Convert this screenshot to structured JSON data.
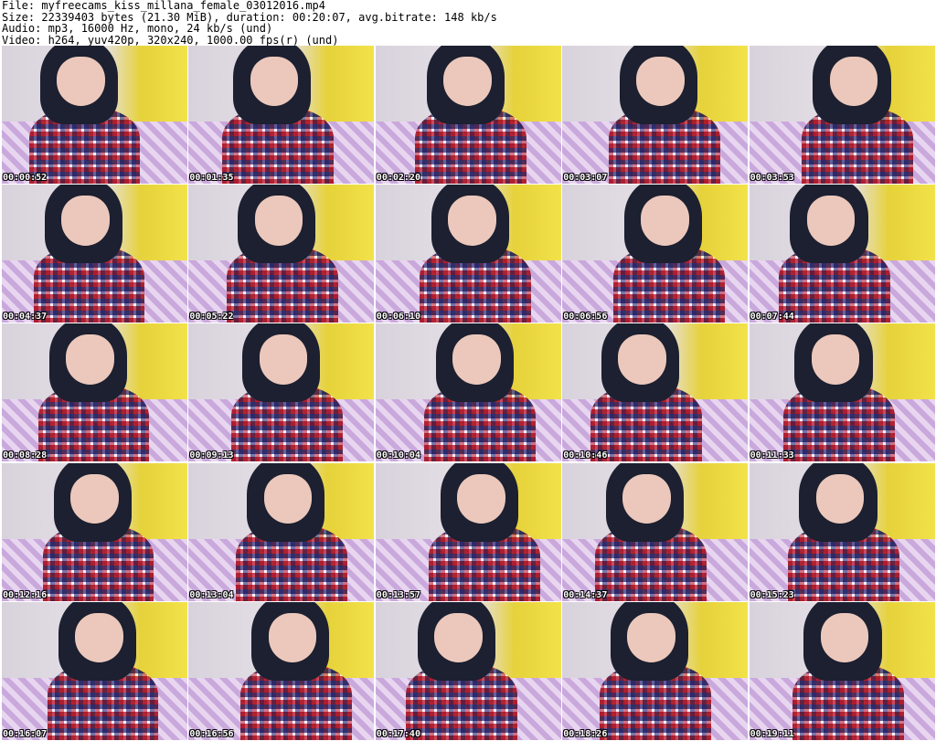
{
  "header": {
    "file": "File: myfreecams_kiss_millana_female_03012016.mp4",
    "size": "Size: 22339403 bytes (21.30 MiB), duration: 00:20:07, avg.bitrate: 148 kb/s",
    "audio": "Audio: mp3, 16000 Hz, mono, 24 kb/s (und)",
    "video": "Video: h264, yuv420p, 320x240, 1000.00 fps(r) (und)"
  },
  "thumbnails": [
    "00:00:52",
    "00:01:35",
    "00:02:20",
    "00:03:07",
    "00:03:53",
    "00:04:37",
    "00:05:22",
    "00:06:10",
    "00:06:56",
    "00:07:44",
    "00:08:28",
    "00:09:13",
    "00:10:04",
    "00:10:46",
    "00:11:33",
    "00:12:16",
    "00:13:04",
    "00:13:57",
    "00:14:37",
    "00:15:23",
    "00:16:07",
    "00:16:56",
    "00:17:40",
    "00:18:26",
    "00:19:11"
  ]
}
